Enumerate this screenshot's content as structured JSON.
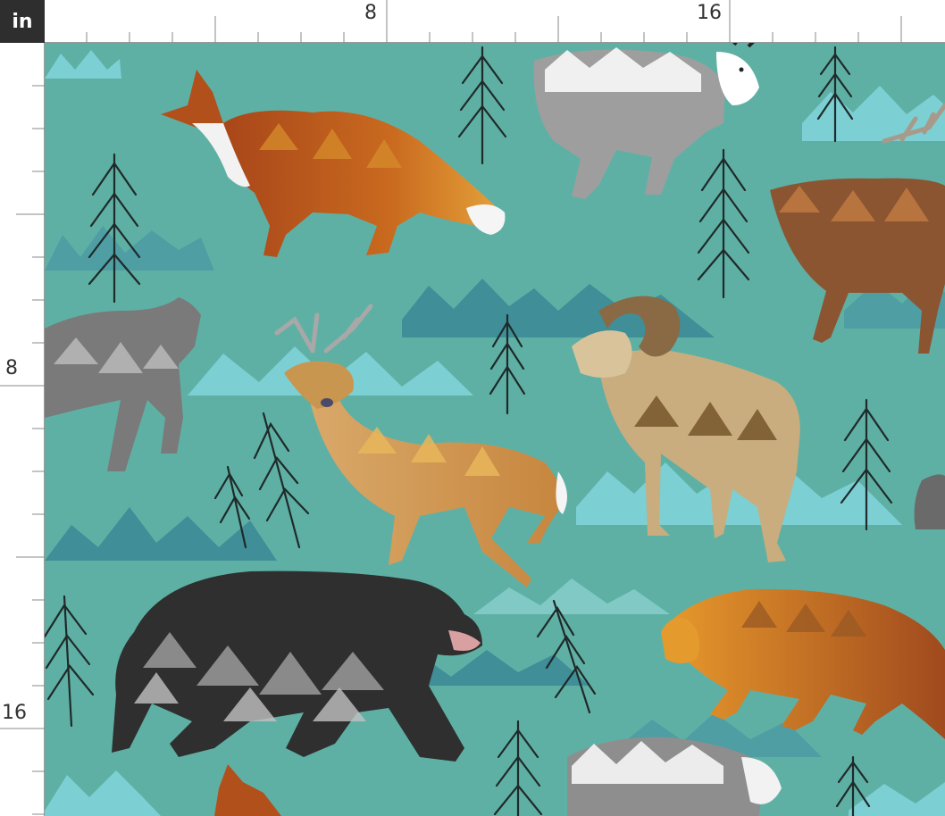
{
  "ruler": {
    "unit": "in",
    "top_labels": [
      "8",
      "16"
    ],
    "left_labels": [
      "8",
      "16"
    ]
  },
  "pattern": {
    "background_color": "#5fb0a4",
    "mountain_colors": [
      "#7ccfd3",
      "#3f8e98",
      "#4e9ea4"
    ],
    "tree_outline_color": "#1f2a2a",
    "animals": [
      {
        "name": "red-fox",
        "primary_color": "#b8561f"
      },
      {
        "name": "mountain-goat",
        "primary_color": "#bdbdbd"
      },
      {
        "name": "elk",
        "primary_color": "#8c5532"
      },
      {
        "name": "gray-wolf",
        "primary_color": "#7a7a7a"
      },
      {
        "name": "white-tailed-deer",
        "primary_color": "#d0a160"
      },
      {
        "name": "bighorn-sheep",
        "primary_color": "#c9ad7e"
      },
      {
        "name": "black-bear",
        "primary_color": "#2f2f2f"
      },
      {
        "name": "mountain-lion",
        "primary_color": "#d98a2b"
      }
    ]
  }
}
